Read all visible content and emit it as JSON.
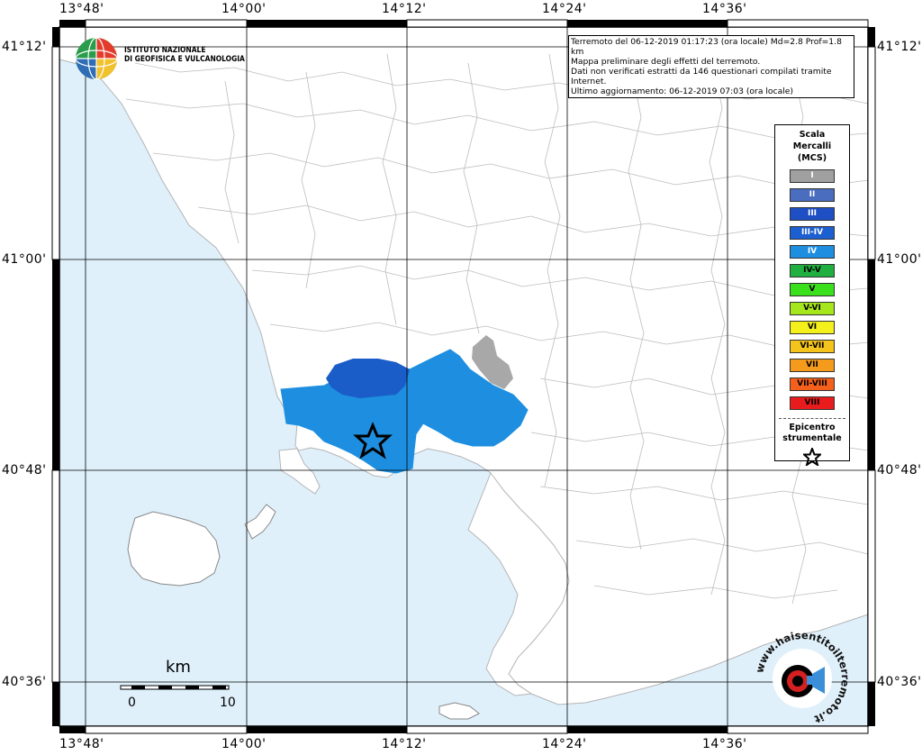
{
  "map": {
    "lon_ticks": [
      "13°48'",
      "14°00'",
      "14°12'",
      "14°24'",
      "14°36'"
    ],
    "lat_ticks": [
      "41°12'",
      "41°00'",
      "40°48'",
      "40°36'"
    ],
    "colors": {
      "sea": "#dff0fb",
      "land": "#ffffff",
      "border": "#b8b8b8",
      "grid": "#000000",
      "intensity_iv": "#1e8fe0",
      "intensity_iii": "#1a5cc8",
      "intensity_i": "#a8a8a8"
    }
  },
  "header": {
    "logo_line1": "ISTITUTO NAZIONALE",
    "logo_line2": "DI GEOFISICA E VULCANOLOGIA"
  },
  "info": {
    "line1": "Terremoto del 06-12-2019 01:17:23 (ora locale) Md=2.8 Prof=1.8 km",
    "line2": "Mappa preliminare degli effetti del terremoto.",
    "line3": "Dati non verificati estratti da 146 questionari compilati tramite Internet.",
    "line4": "Ultimo aggiornamento: 06-12-2019 07:03 (ora locale)"
  },
  "legend": {
    "title1": "Scala",
    "title2": "Mercalli",
    "title3": "(MCS)",
    "items": [
      {
        "label": "I",
        "color": "#a0a0a0",
        "text": "#ffffff"
      },
      {
        "label": "II",
        "color": "#4a6dc0",
        "text": "#ffffff"
      },
      {
        "label": "III",
        "color": "#1f4fc4",
        "text": "#ffffff"
      },
      {
        "label": "III-IV",
        "color": "#1c5fd0",
        "text": "#ffffff"
      },
      {
        "label": "IV",
        "color": "#1e8fe0",
        "text": "#ffffff"
      },
      {
        "label": "IV-V",
        "color": "#20b040",
        "text": "#000000"
      },
      {
        "label": "V",
        "color": "#3ae01c",
        "text": "#000000"
      },
      {
        "label": "V-VI",
        "color": "#a6e61c",
        "text": "#000000"
      },
      {
        "label": "VI",
        "color": "#f4f01c",
        "text": "#000000"
      },
      {
        "label": "VI-VII",
        "color": "#f4c41c",
        "text": "#000000"
      },
      {
        "label": "VII",
        "color": "#f49a1c",
        "text": "#000000"
      },
      {
        "label": "VII-VIII",
        "color": "#f4601c",
        "text": "#000000"
      },
      {
        "label": "VIII",
        "color": "#e81c1c",
        "text": "#000000"
      }
    ],
    "epi_line1": "Epicentro",
    "epi_line2": "strumentale"
  },
  "scale": {
    "unit": "km",
    "min": "0",
    "max": "10"
  },
  "badge": {
    "text": "www.haisentitoilterremoto.it"
  }
}
